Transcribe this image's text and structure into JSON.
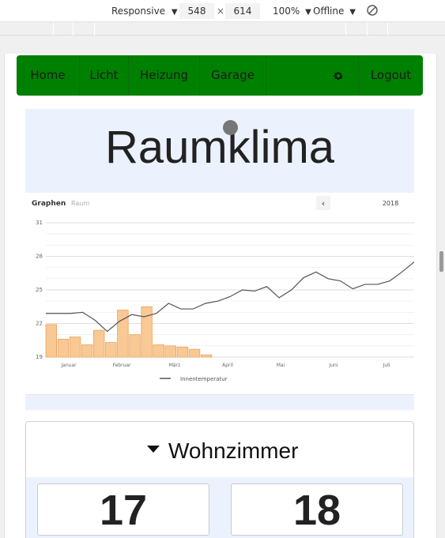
{
  "devtools": {
    "device": "Responsive",
    "width": "548",
    "height": "614",
    "times": "×",
    "zoom": "100%",
    "network": "Offline",
    "caret": "▼"
  },
  "nav": {
    "items": [
      "Home",
      "Licht",
      "Heizung",
      "Garage"
    ],
    "logout": "Logout",
    "color": "#008000"
  },
  "page": {
    "title": "Raumklima"
  },
  "chart_header": {
    "tab_active": "Graphen",
    "tab_inactive": "Raum",
    "prev": "‹",
    "year": "2018"
  },
  "chart_data": {
    "type": "bar+line",
    "title": "",
    "ylim": [
      19,
      31
    ],
    "yticks": [
      19,
      22,
      25,
      28,
      31
    ],
    "x_ticks": [
      "Januar",
      "Februar",
      "März",
      "April",
      "Mai",
      "Juni",
      "Juli"
    ],
    "legend": [
      "Innentemperatur"
    ],
    "legend_position": "bottom",
    "grid": true,
    "bars": {
      "color": "#f9c995",
      "values": [
        21.9,
        20.6,
        20.8,
        20.1,
        21.4,
        20.3,
        23.2,
        21.0,
        23.5,
        20.1,
        20.0,
        19.9,
        19.7,
        19.2
      ]
    },
    "series": [
      {
        "name": "Innentemperatur",
        "color": "#555555",
        "values": [
          22.9,
          22.9,
          22.9,
          23.0,
          22.3,
          21.3,
          22.2,
          22.8,
          22.6,
          22.9,
          23.8,
          23.3,
          23.3,
          23.8,
          24.0,
          24.4,
          25.0,
          24.9,
          25.3,
          24.3,
          25.0,
          26.1,
          26.6,
          26.0,
          25.8,
          25.1,
          25.5,
          25.5,
          25.8,
          26.6,
          27.5
        ]
      }
    ]
  },
  "room": {
    "name": "Wohnzimmer",
    "values": [
      "17",
      "18"
    ]
  },
  "icons": {
    "dropdown": "caret-down-icon",
    "settings": "gear-icon",
    "rotate": "rotate-icon",
    "back": "chevron-left-icon"
  }
}
